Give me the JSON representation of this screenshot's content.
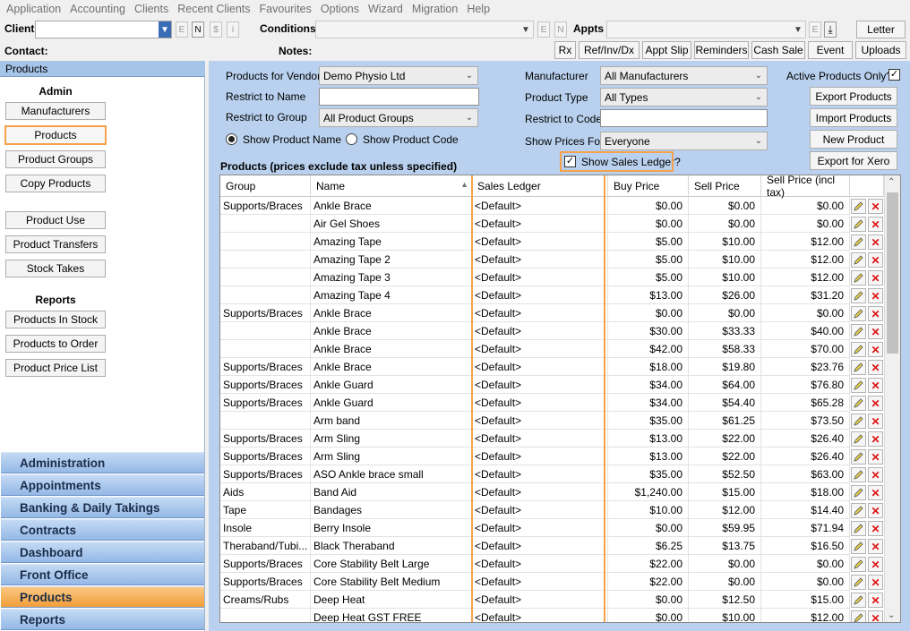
{
  "menu": [
    "Application",
    "Accounting",
    "Clients",
    "Recent Clients",
    "Favourites",
    "Options",
    "Wizard",
    "Migration",
    "Help"
  ],
  "toolbar": {
    "client_label": "Client",
    "client_small": [
      "E",
      "N",
      "$",
      "i"
    ],
    "conditions_label": "Conditions",
    "conditions_small": [
      "E",
      "N"
    ],
    "appts_label": "Appts",
    "appts_small": "E",
    "letter_button": "Letter",
    "contact_label": "Contact:",
    "notes_label": "Notes:",
    "buttons": [
      "Rx",
      "Ref/Inv/Dx",
      "Appt Slip",
      "Reminders",
      "Cash Sale",
      "Event",
      "Uploads"
    ]
  },
  "sidebar": {
    "title": "Products",
    "admin_heading": "Admin",
    "admin_items": [
      "Manufacturers",
      "Products",
      "Product Groups",
      "Copy Products"
    ],
    "mid_items": [
      "Product Use",
      "Product Transfers",
      "Stock Takes"
    ],
    "reports_heading": "Reports",
    "report_items": [
      "Products In Stock",
      "Products to Order",
      "Product Price List"
    ],
    "nav": [
      "Administration",
      "Appointments",
      "Banking & Daily Takings",
      "Contracts",
      "Dashboard",
      "Front Office",
      "Products",
      "Reports"
    ],
    "active_nav": "Products",
    "active_item": "Products"
  },
  "filters": {
    "vendor_label": "Products for Vendor",
    "vendor_value": "Demo Physio Ltd",
    "name_label": "Restrict to Name",
    "name_value": "",
    "group_label": "Restrict to Group",
    "group_value": "All Product Groups",
    "radio_name": "Show Product Name",
    "radio_code": "Show Product Code",
    "manufacturer_label": "Manufacturer",
    "manufacturer_value": "All Manufacturers",
    "type_label": "Product Type",
    "type_value": "All Types",
    "code_label": "Restrict to Code",
    "code_value": "",
    "prices_label": "Show Prices For",
    "prices_value": "Everyone",
    "active_label": "Active Products Only?",
    "ledger_label": "Show Sales Ledger?"
  },
  "actions": [
    "Export Products",
    "Import Products",
    "New Product",
    "Export for Xero"
  ],
  "grid": {
    "caption": "Products (prices exclude tax unless specified)",
    "columns": [
      "Group",
      "Name",
      "Sales Ledger",
      "Buy Price",
      "Sell Price",
      "Sell Price (incl tax)"
    ],
    "rows": [
      [
        "Supports/Braces",
        "Ankle Brace",
        "<Default>",
        "$0.00",
        "$0.00",
        "$0.00"
      ],
      [
        "",
        "Air Gel Shoes",
        "<Default>",
        "$0.00",
        "$0.00",
        "$0.00"
      ],
      [
        "",
        "Amazing Tape",
        "<Default>",
        "$5.00",
        "$10.00",
        "$12.00"
      ],
      [
        "",
        "Amazing Tape 2",
        "<Default>",
        "$5.00",
        "$10.00",
        "$12.00"
      ],
      [
        "",
        "Amazing Tape 3",
        "<Default>",
        "$5.00",
        "$10.00",
        "$12.00"
      ],
      [
        "",
        "Amazing Tape 4",
        "<Default>",
        "$13.00",
        "$26.00",
        "$31.20"
      ],
      [
        "Supports/Braces",
        "Ankle Brace",
        "<Default>",
        "$0.00",
        "$0.00",
        "$0.00"
      ],
      [
        "",
        "Ankle Brace",
        "<Default>",
        "$30.00",
        "$33.33",
        "$40.00"
      ],
      [
        "",
        "Ankle Brace",
        "<Default>",
        "$42.00",
        "$58.33",
        "$70.00"
      ],
      [
        "Supports/Braces",
        "Ankle Brace",
        "<Default>",
        "$18.00",
        "$19.80",
        "$23.76"
      ],
      [
        "Supports/Braces",
        "Ankle Guard",
        "<Default>",
        "$34.00",
        "$64.00",
        "$76.80"
      ],
      [
        "Supports/Braces",
        "Ankle Guard",
        "<Default>",
        "$34.00",
        "$54.40",
        "$65.28"
      ],
      [
        "",
        "Arm band",
        "<Default>",
        "$35.00",
        "$61.25",
        "$73.50"
      ],
      [
        "Supports/Braces",
        "Arm Sling",
        "<Default>",
        "$13.00",
        "$22.00",
        "$26.40"
      ],
      [
        "Supports/Braces",
        "Arm Sling",
        "<Default>",
        "$13.00",
        "$22.00",
        "$26.40"
      ],
      [
        "Supports/Braces",
        "ASO Ankle brace small",
        "<Default>",
        "$35.00",
        "$52.50",
        "$63.00"
      ],
      [
        "Aids",
        "Band Aid",
        "<Default>",
        "$1,240.00",
        "$15.00",
        "$18.00"
      ],
      [
        "Tape",
        "Bandages",
        "<Default>",
        "$10.00",
        "$12.00",
        "$14.40"
      ],
      [
        "Insole",
        "Berry Insole",
        "<Default>",
        "$0.00",
        "$59.95",
        "$71.94"
      ],
      [
        "Theraband/Tubi...",
        "Black Theraband",
        "<Default>",
        "$6.25",
        "$13.75",
        "$16.50"
      ],
      [
        "Supports/Braces",
        "Core Stability Belt Large",
        "<Default>",
        "$22.00",
        "$0.00",
        "$0.00"
      ],
      [
        "Supports/Braces",
        "Core Stability Belt Medium",
        "<Default>",
        "$22.00",
        "$0.00",
        "$0.00"
      ],
      [
        "Creams/Rubs",
        "Deep Heat",
        "<Default>",
        "$0.00",
        "$12.50",
        "$15.00"
      ],
      [
        "",
        "Deep Heat GST FREE",
        "<Default>",
        "$0.00",
        "$10.00",
        "$12.00"
      ]
    ]
  },
  "colors": {
    "highlight": "#f5a24b",
    "panel": "#b9d1ee",
    "nav": "#a9c8ee",
    "delete": "#dd1111"
  },
  "icons": {
    "edit": "pencil-icon",
    "delete": "delete-x-icon"
  }
}
